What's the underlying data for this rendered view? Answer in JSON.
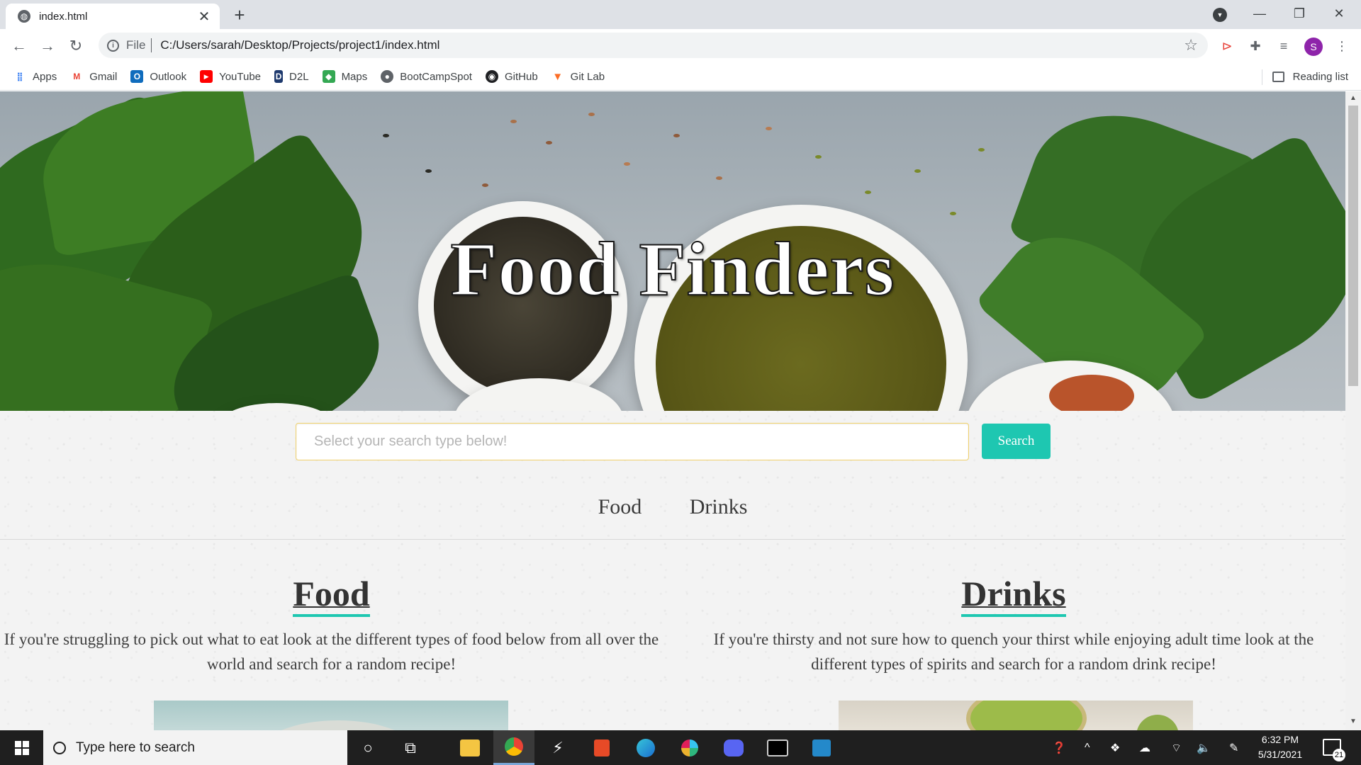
{
  "browser": {
    "tab_title": "index.html",
    "tab_close": "✕",
    "new_tab": "+",
    "url_scheme": "File",
    "url": "C:/Users/sarah/Desktop/Projects/project1/index.html",
    "profile_initial": "S",
    "reading_list": "Reading list",
    "bookmarks": [
      {
        "label": "Apps",
        "icon": "apps-grid-icon",
        "color": "#4285f4"
      },
      {
        "label": "Gmail",
        "icon": "gmail-icon",
        "color": "#ea4335"
      },
      {
        "label": "Outlook",
        "icon": "outlook-icon",
        "color": "#0f6cbd"
      },
      {
        "label": "YouTube",
        "icon": "youtube-icon",
        "color": "#ff0000"
      },
      {
        "label": "D2L",
        "icon": "d2l-icon",
        "color": "#1f3a6e"
      },
      {
        "label": "Maps",
        "icon": "maps-icon",
        "color": "#34a853"
      },
      {
        "label": "BootCampSpot",
        "icon": "bootcampspot-icon",
        "color": "#5f6368"
      },
      {
        "label": "GitHub",
        "icon": "github-icon",
        "color": "#202124"
      },
      {
        "label": "Git Lab",
        "icon": "gitlab-icon",
        "color": "#fc6d26"
      }
    ]
  },
  "page": {
    "hero_title": "Food Finders",
    "search_placeholder": "Select your search type below!",
    "search_button": "Search",
    "tabs": [
      "Food",
      "Drinks"
    ],
    "food": {
      "heading": "Food",
      "text": "If you're struggling to pick out what to eat look at the different types of food below from all over the world and search for a random recipe!"
    },
    "drinks": {
      "heading": "Drinks",
      "text": "If you're thirsty and not sure how to quench your thirst while enjoying adult time look at the different types of spirits and search for a random drink recipe!"
    },
    "accent_color": "#1ec7b1"
  },
  "taskbar": {
    "search_placeholder": "Type here to search",
    "time": "6:32 PM",
    "date": "5/31/2021",
    "notification_count": "21"
  }
}
